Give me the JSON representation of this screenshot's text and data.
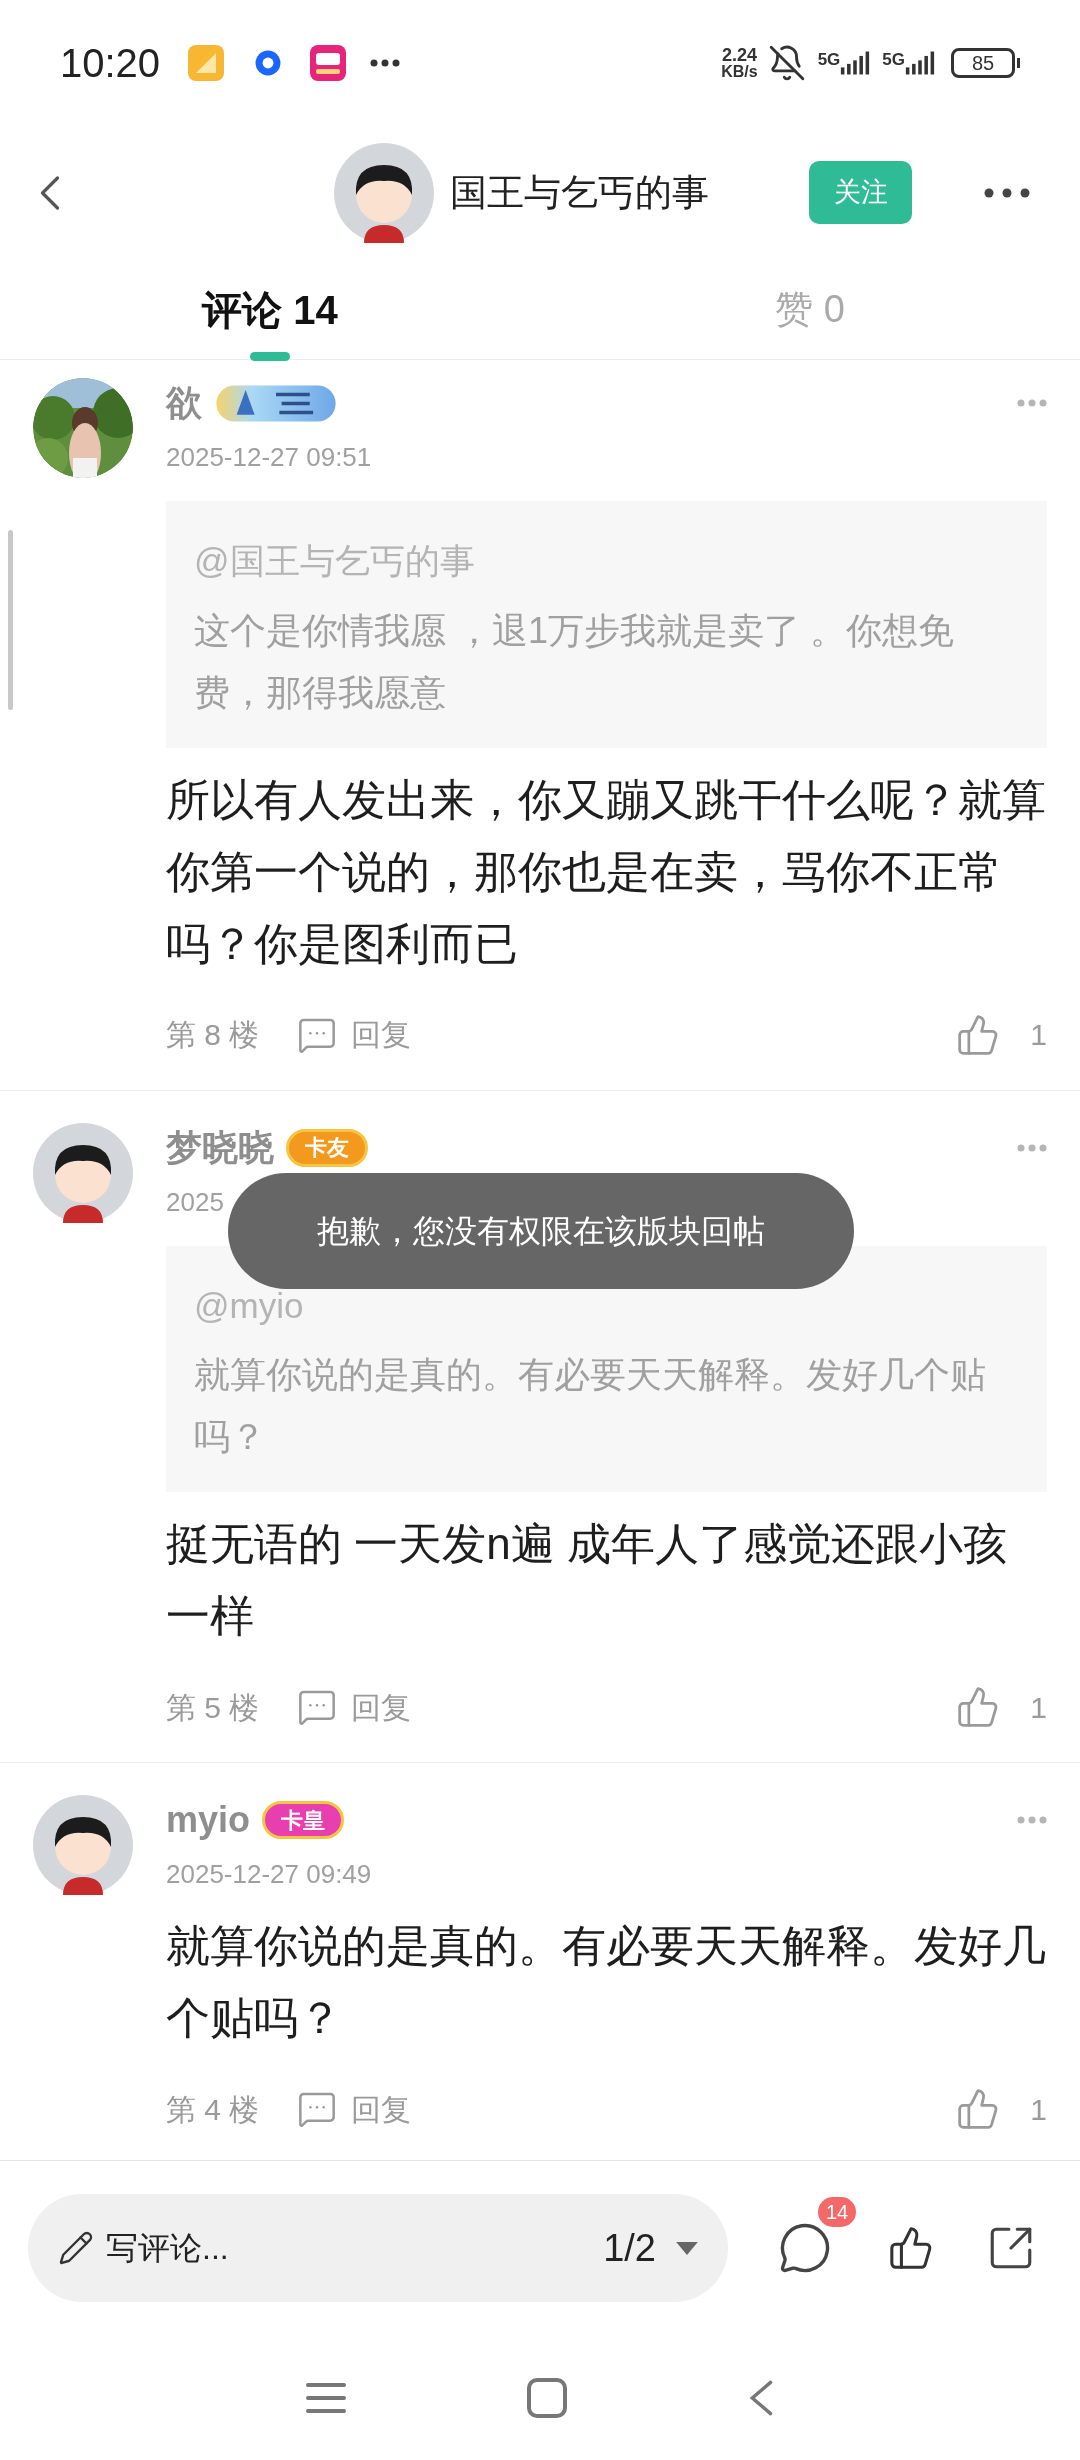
{
  "status_bar": {
    "time": "10:20",
    "net_speed": "2.24",
    "net_unit": "KB/s",
    "signal_1": "5G",
    "signal_2": "5G",
    "battery": "85"
  },
  "header": {
    "title": "国王与乞丐的事",
    "follow": "关注"
  },
  "tabs": [
    {
      "label": "评论 14",
      "selected": true
    },
    {
      "label": "赞 0",
      "selected": false
    }
  ],
  "comments": [
    {
      "name": "欲",
      "date": "2025-12-27 09:51",
      "quote": {
        "mention": "@国王与乞丐的事",
        "text": "这个是你情我愿 ，退1万步我就是卖了 。你想免费，那得我愿意"
      },
      "body": "所以有人发出来，你又蹦又跳干什么呢？就算你第一个说的，那你也是在卖，骂你不正常吗？你是图利而已",
      "floor": "第 8 楼",
      "reply": "回复",
      "likes": "1"
    },
    {
      "avatar": {
        "kind": "icon"
      },
      "name": "梦晓晓",
      "badge": {
        "kind": "text",
        "label": "卡友",
        "color": "#f39a1e"
      },
      "date": "2025",
      "quote": {
        "mention": "@myio",
        "text": "就算你说的是真的。有必要天天解释。发好几个贴吗？"
      },
      "body": "挺无语的 一天发n遍 成年人了感觉还跟小孩一样",
      "floor": "第 5 楼",
      "reply": "回复",
      "likes": "1"
    },
    {
      "avatar": {
        "kind": "icon"
      },
      "name": "myio",
      "badge": {
        "kind": "text",
        "label": "卡皇",
        "color": "#e83fb0"
      },
      "date": "2025-12-27 09:49",
      "body": "就算你说的是真的。有必要天天解释。发好几个贴吗？",
      "floor": "第 4 楼",
      "reply": "回复",
      "likes": "1"
    }
  ],
  "toast": "抱歉，您没有权限在该版块回帖",
  "bottom_bar": {
    "placeholder": "写评论...",
    "page": "1/2",
    "comment_count": "14"
  }
}
